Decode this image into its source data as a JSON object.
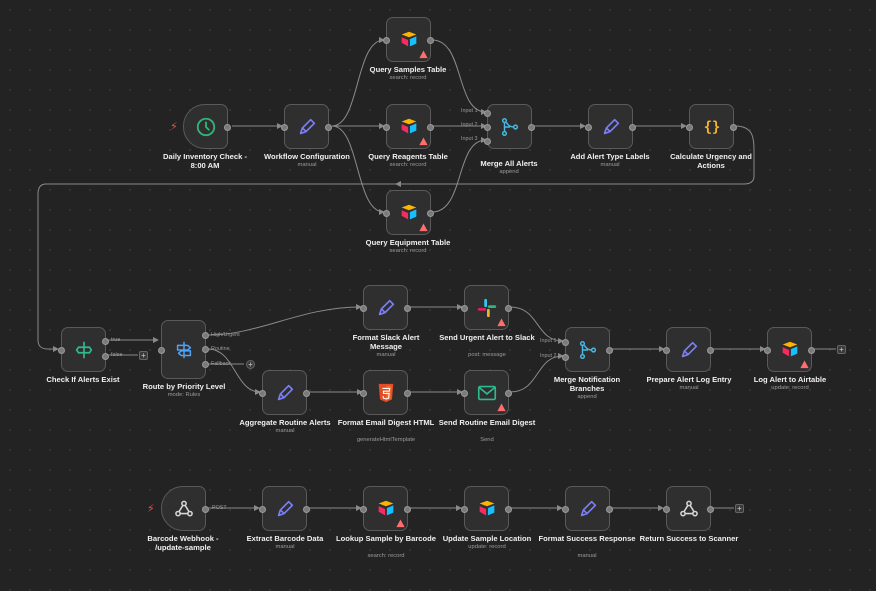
{
  "colors": {
    "background": "#232323",
    "edge": "#8a8a8a",
    "pencil": "#7b7ff5",
    "trigger_green": "#32b37a",
    "filter_green": "#2fb98f",
    "switch_blue": "#4fa3f7",
    "merge_cyan": "#49b8e3",
    "code_orange": "#f3b728",
    "warning": "#ff6d6d",
    "webhook": "#d6d6d6"
  },
  "nodes": [
    {
      "id": "daily",
      "name": "Daily Inventory Check - 8:00 AM",
      "subtitle": "",
      "icon": "clock-icon"
    },
    {
      "id": "wfconf",
      "name": "Workflow Configuration",
      "subtitle": "manual",
      "icon": "pencil-icon"
    },
    {
      "id": "qsamples",
      "name": "Query Samples Table",
      "subtitle": "search: record",
      "icon": "airtable-icon"
    },
    {
      "id": "qreagents",
      "name": "Query Reagents Table",
      "subtitle": "search: record",
      "icon": "airtable-icon"
    },
    {
      "id": "qequip",
      "name": "Query Equipment Table",
      "subtitle": "search: record",
      "icon": "airtable-icon"
    },
    {
      "id": "mergeall",
      "name": "Merge All Alerts",
      "subtitle": "append",
      "icon": "merge-icon"
    },
    {
      "id": "addlabels",
      "name": "Add Alert Type Labels",
      "subtitle": "manual",
      "icon": "pencil-icon"
    },
    {
      "id": "calcurg",
      "name": "Calculate Urgency and Actions",
      "subtitle": "",
      "icon": "code-braces-icon"
    },
    {
      "id": "checkif",
      "name": "Check If Alerts Exist",
      "subtitle": "",
      "icon": "filter-icon"
    },
    {
      "id": "route",
      "name": "Route by Priority Level",
      "subtitle": "mode: Rules",
      "icon": "switch-icon"
    },
    {
      "id": "fmtslack",
      "name": "Format Slack Alert Message",
      "subtitle": "manual",
      "icon": "pencil-icon"
    },
    {
      "id": "sendslack",
      "name": "Send Urgent Alert to Slack",
      "subtitle": "post: message",
      "icon": "slack-icon"
    },
    {
      "id": "aggr",
      "name": "Aggregate Routine Alerts",
      "subtitle": "manual",
      "icon": "pencil-icon"
    },
    {
      "id": "fmtemail",
      "name": "Format Email Digest HTML",
      "subtitle": "generateHtmlTemplate",
      "icon": "html5-icon"
    },
    {
      "id": "sendemail",
      "name": "Send Routine Email Digest",
      "subtitle": "Send",
      "icon": "email-icon"
    },
    {
      "id": "mergenotif",
      "name": "Merge Notification Branches",
      "subtitle": "append",
      "icon": "merge-icon"
    },
    {
      "id": "preplog",
      "name": "Prepare Alert Log Entry",
      "subtitle": "manual",
      "icon": "pencil-icon"
    },
    {
      "id": "logair",
      "name": "Log Alert to Airtable",
      "subtitle": "update: record",
      "icon": "airtable-icon"
    },
    {
      "id": "barcode",
      "name": "Barcode Webhook - /update-sample",
      "subtitle": "",
      "icon": "webhook-icon"
    },
    {
      "id": "extract",
      "name": "Extract Barcode Data",
      "subtitle": "manual",
      "icon": "pencil-icon"
    },
    {
      "id": "lookup",
      "name": "Lookup Sample by Barcode",
      "subtitle": "search: record",
      "icon": "airtable-icon"
    },
    {
      "id": "updloc",
      "name": "Update Sample Location",
      "subtitle": "update: record",
      "icon": "airtable-icon"
    },
    {
      "id": "fmtsucc",
      "name": "Format Success Response",
      "subtitle": "manual",
      "icon": "pencil-icon"
    },
    {
      "id": "retsucc",
      "name": "Return Success to Scanner",
      "subtitle": "",
      "icon": "webhook-icon"
    }
  ],
  "port_labels": {
    "merge_all_in1": "Input 1",
    "merge_all_in2": "Input 2",
    "merge_all_in3": "Input 3",
    "check_true": "true",
    "check_false": "false",
    "route_high": "High/Urgent",
    "route_routine": "Routine",
    "route_fallback": "Fallback",
    "merge_notif_in1": "Input 1",
    "merge_notif_in2": "Input 2",
    "webhook_post": "POST"
  },
  "add_button": "+"
}
